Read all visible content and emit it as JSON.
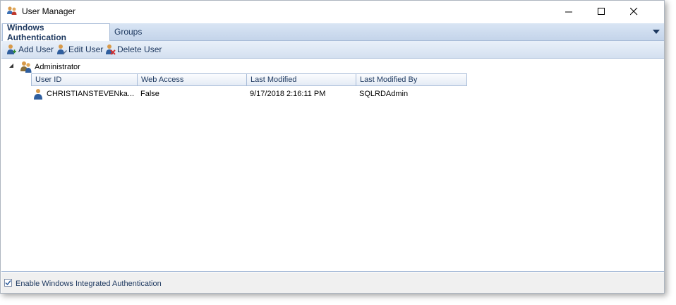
{
  "window": {
    "title": "User Manager",
    "icon": "users-icon"
  },
  "controls": {
    "minimize_icon": "minimize-icon",
    "maximize_icon": "maximize-icon",
    "close_icon": "close-icon"
  },
  "tabs": [
    {
      "label": "Windows Authentication",
      "active": true
    },
    {
      "label": "Groups",
      "active": false
    }
  ],
  "toolbar": {
    "add_label": "Add User",
    "edit_label": "Edit User",
    "delete_label": "Delete User"
  },
  "tree": {
    "group_label": "Administrator",
    "expanded": true
  },
  "grid": {
    "columns": [
      "User ID",
      "Web Access",
      "Last Modified",
      "Last Modified By"
    ],
    "rows": [
      {
        "user_id": "CHRISTIANSTEVENka...",
        "web_access": "False",
        "last_modified": "9/17/2018 2:16:11 PM",
        "last_modified_by": "SQLRDAdmin"
      }
    ]
  },
  "footer": {
    "checkbox_label": "Enable Windows Integrated Authentication",
    "checked": true
  },
  "colors": {
    "accent": "#1e3960",
    "tab_bg": "#d9e5f4",
    "border": "#a8bcd8"
  }
}
